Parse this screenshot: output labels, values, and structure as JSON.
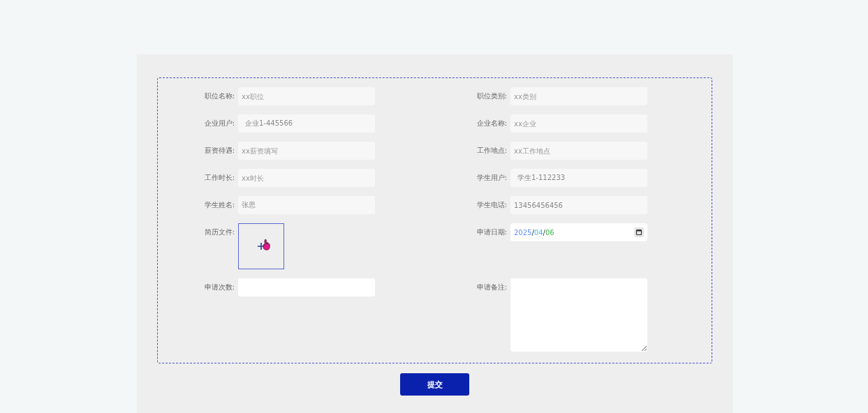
{
  "fields": [
    {
      "label": "职位名称:",
      "kind": "readonly",
      "placeholder": "xx职位"
    },
    {
      "label": "职位类别:",
      "kind": "readonly",
      "placeholder": "xx类别"
    },
    {
      "label": "企业用户:",
      "kind": "select",
      "value": "企业1-445566"
    },
    {
      "label": "企业名称:",
      "kind": "readonly",
      "placeholder": "xx企业"
    },
    {
      "label": "薪资待遇:",
      "kind": "readonly",
      "placeholder": "xx薪资填写"
    },
    {
      "label": "工作地点:",
      "kind": "readonly",
      "placeholder": "xx工作地点"
    },
    {
      "label": "工作时长:",
      "kind": "readonly",
      "placeholder": "xx时长"
    },
    {
      "label": "学生用户:",
      "kind": "select",
      "value": "学生1-112233"
    },
    {
      "label": "学生姓名:",
      "kind": "readonly",
      "value": "张思"
    },
    {
      "label": "学生电话:",
      "kind": "readonly",
      "value": "13456456456"
    },
    {
      "label": "简历文件:",
      "kind": "upload"
    },
    {
      "label": "申请日期:",
      "kind": "date",
      "parts": [
        {
          "text": "2025",
          "color": "#5b8ff9"
        },
        {
          "text": "04",
          "color": "#3fb8e8"
        },
        {
          "text": "06",
          "color": "#3bb54a"
        }
      ],
      "separator": "/"
    },
    {
      "label": "申请次数:",
      "kind": "text"
    },
    {
      "label": "申请备注:",
      "kind": "textarea"
    }
  ],
  "submit": "提交"
}
